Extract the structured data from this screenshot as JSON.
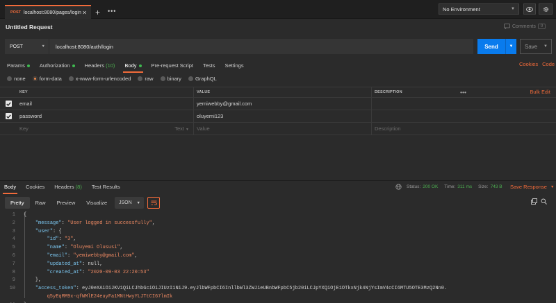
{
  "tab": {
    "method": "POST",
    "url": "localhost:8080/pages/login"
  },
  "environment": {
    "selected": "No Environment"
  },
  "request": {
    "title": "Untitled Request",
    "comments_label": "Comments",
    "comments_count": "0",
    "method": "POST",
    "url": "localhost:8080/auth/login",
    "send_label": "Send",
    "save_label": "Save"
  },
  "request_tabs": [
    {
      "label": "Params",
      "dot": true
    },
    {
      "label": "Authorization",
      "dot": true
    },
    {
      "label": "Headers",
      "count": "(10)"
    },
    {
      "label": "Body",
      "dot": true
    },
    {
      "label": "Pre-request Script"
    },
    {
      "label": "Tests"
    },
    {
      "label": "Settings"
    }
  ],
  "request_links": {
    "cookies": "Cookies",
    "code": "Code"
  },
  "body_types": [
    "none",
    "form-data",
    "x-www-form-urlencoded",
    "raw",
    "binary",
    "GraphQL"
  ],
  "table": {
    "headers": {
      "key": "KEY",
      "value": "VALUE",
      "description": "DESCRIPTION",
      "bulk_edit": "Bulk Edit"
    },
    "rows": [
      {
        "key": "email",
        "value": "yemiwebby@gmail.com"
      },
      {
        "key": "password",
        "value": "oluyemi123"
      }
    ],
    "placeholder": {
      "key": "Key",
      "type": "Text",
      "value": "Value",
      "description": "Description"
    }
  },
  "response_tabs": [
    {
      "label": "Body"
    },
    {
      "label": "Cookies"
    },
    {
      "label": "Headers",
      "count": "(8)"
    },
    {
      "label": "Test Results"
    }
  ],
  "response_status": {
    "status_label": "Status:",
    "status": "200 OK",
    "time_label": "Time:",
    "time": "311 ms",
    "size_label": "Size:",
    "size": "743 B",
    "save_response": "Save Response"
  },
  "view_modes": [
    "Pretty",
    "Raw",
    "Preview",
    "Visualize"
  ],
  "format": "JSON",
  "code_lines": [
    {
      "n": "1",
      "t": "{"
    },
    {
      "n": "2",
      "t": "    \"message\": \"User logged in successfully\","
    },
    {
      "n": "3",
      "t": "    \"user\": {"
    },
    {
      "n": "4",
      "t": "        \"id\": \"3\","
    },
    {
      "n": "5",
      "t": "        \"name\": \"Oluyemi Olususi\","
    },
    {
      "n": "6",
      "t": "        \"email\": \"yemiwebby@gmail.com\","
    },
    {
      "n": "7",
      "t": "        \"updated_at\": null,"
    },
    {
      "n": "8",
      "t": "        \"created_at\": \"2020-09-03 22:20:53\""
    },
    {
      "n": "9",
      "t": "    },"
    },
    {
      "n": "10",
      "t": "    \"access_token\": \"eyJ0eXAiOiJKV1QiLCJhbGciOiJIUzI1NiJ9.eyJlbWFpbCI6InllbWl3ZWJieUBnbWFpbC5jb20iLCJpYXQiOjE1OTkxNjk4NjYsImV4cCI6MTU5OTE3MzQ2Nn0."
    },
    {
      "n": "",
      "t": "        q5yEqMM9x-qfWMlE24euyFa1MNtHwyYLJTtCI67lmIk\""
    },
    {
      "n": "11",
      "t": "}"
    }
  ]
}
